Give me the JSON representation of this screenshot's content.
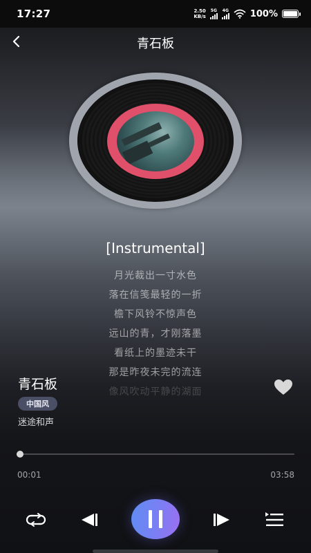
{
  "status_bar": {
    "time": "17:27",
    "net_speed_value": "2.50",
    "net_speed_unit": "KB/s",
    "signal_1_label": "5G",
    "signal_2_label": "4G",
    "battery_percent": "100%",
    "icons": [
      "wifi-icon",
      "battery-icon",
      "signal-icon"
    ]
  },
  "header": {
    "title": "青石板",
    "back_icon": "chevron-left-icon"
  },
  "now_playing": {
    "current_lyric": "[Instrumental]",
    "lyrics": [
      "月光裁出一寸水色",
      "落在信笺最轻的一折",
      "檐下风铃不惊声色",
      "远山的青，才刚落墨",
      "看纸上的墨迹未干",
      "那是昨夜未完的流连",
      "像风吹动平静的湖面"
    ]
  },
  "song": {
    "title": "青石板",
    "tag": "中国风",
    "artist": "迷途和声",
    "favorite_icon": "heart-icon"
  },
  "playback": {
    "current_time": "00:01",
    "total_time": "03:58",
    "progress": 0.004
  },
  "controls": {
    "icons": [
      "repeat-icon",
      "previous-icon",
      "pause-icon",
      "next-icon",
      "playlist-icon"
    ]
  },
  "colors": {
    "accent_gradient_start": "#5f8df2",
    "accent_gradient_end": "#9d6ff0",
    "disc_ring": "#e0506a",
    "tag_bg": "#4b4f66"
  }
}
